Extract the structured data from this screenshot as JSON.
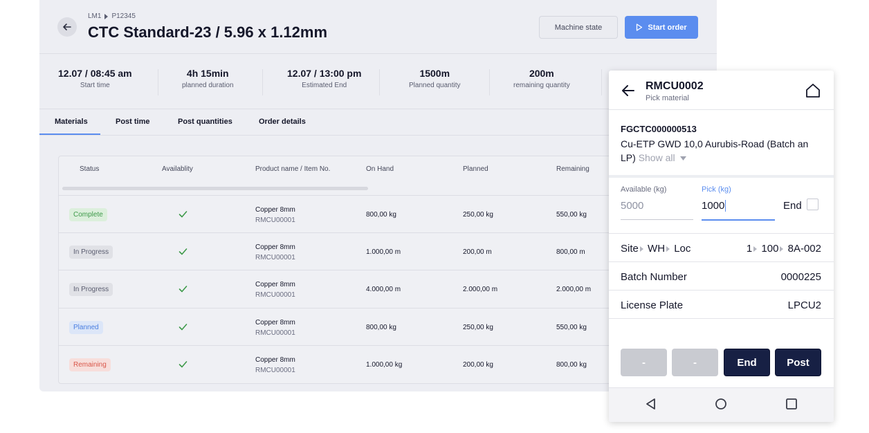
{
  "header": {
    "breadcrumb": [
      "LM1",
      "P12345"
    ],
    "title": "CTC Standard-23 / 5.96 x 1.12mm",
    "machine_state_label": "Machine state",
    "start_order_label": "Start order"
  },
  "stats": [
    {
      "value": "12.07 / 08:45 am",
      "label": "Start time"
    },
    {
      "value": "4h 15min",
      "label": "planned duration"
    },
    {
      "value": "12.07 / 13:00 pm",
      "label": "Estimated End"
    },
    {
      "value": "1500m",
      "label": "Planned quantity"
    },
    {
      "value": "200m",
      "label": "remaining quantity"
    }
  ],
  "tabs": [
    "Materials",
    "Post time",
    "Post quantities",
    "Order details"
  ],
  "table": {
    "headers": [
      "Status",
      "Availablity",
      "Product name / Item No.",
      "On Hand",
      "Planned",
      "Remaining"
    ],
    "rows": [
      {
        "status": "Complete",
        "name": "Copper 8mm",
        "item": "RMCU00001",
        "on_hand": "800,00 kg",
        "planned": "250,00 kg",
        "remaining": "550,00 kg"
      },
      {
        "status": "In Progress",
        "name": "Copper 8mm",
        "item": "RMCU00001",
        "on_hand": "1.000,00 m",
        "planned": "200,00 m",
        "remaining": "800,00 m"
      },
      {
        "status": "In Progress",
        "name": "Copper 8mm",
        "item": "RMCU00001",
        "on_hand": "4.000,00 m",
        "planned": "2.000,00 m",
        "remaining": "2.000,00 m"
      },
      {
        "status": "Planned",
        "name": "Copper 8mm",
        "item": "RMCU00001",
        "on_hand": "800,00 kg",
        "planned": "250,00 kg",
        "remaining": "550,00 kg"
      },
      {
        "status": "Remaining",
        "name": "Copper 8mm",
        "item": "RMCU00001",
        "on_hand": "1.000,00 kg",
        "planned": "200,00 kg",
        "remaining": "800,00 kg"
      }
    ]
  },
  "status_colors": {
    "Complete": {
      "bg": "#dcefdc",
      "fg": "#3e9a4a"
    },
    "In Progress": {
      "bg": "#e0e1e6",
      "fg": "#5a5d70"
    },
    "Planned": {
      "bg": "#dce6f8",
      "fg": "#4a7ee0"
    },
    "Remaining": {
      "bg": "#f7dedb",
      "fg": "#d9574a"
    }
  },
  "mobile": {
    "title": "RMCU0002",
    "subtitle": "Pick material",
    "code": "FGCTC000000513",
    "description": "Cu-ETP GWD 10,0 Aurubis-Road (Batch an LP)",
    "show_all": "Show all",
    "available_label": "Available (kg)",
    "available_value": "5000",
    "pick_label": "Pick (kg)",
    "pick_value": "1000",
    "end_label": "End",
    "location_labels": [
      "Site",
      "WH",
      "Loc"
    ],
    "location_values": [
      "1",
      "100",
      "8A-002"
    ],
    "batch_label": "Batch Number",
    "batch_value": "0000225",
    "lp_label": "License Plate",
    "lp_value": "LPCU2",
    "buttons": [
      "-",
      "-",
      "End",
      "Post"
    ]
  },
  "colors": {
    "accent": "#5b8def",
    "dark_button": "#172044"
  }
}
